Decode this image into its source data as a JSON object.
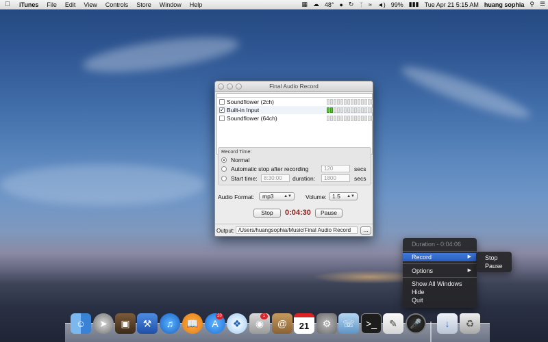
{
  "menubar": {
    "app_name": "iTunes",
    "menus": [
      "File",
      "Edit",
      "View",
      "Controls",
      "Store",
      "Window",
      "Help"
    ],
    "status": {
      "temperature": "48°",
      "battery": "99%",
      "datetime": "Tue Apr 21  5:15 AM",
      "user": "huang sophia"
    }
  },
  "window": {
    "title": "Final Audio Record",
    "devices": [
      {
        "name": "Soundflower (2ch)",
        "checked": false,
        "level": 0
      },
      {
        "name": "Built-in Input",
        "checked": true,
        "level": 0.14
      },
      {
        "name": "Soundflower (64ch)",
        "checked": false,
        "level": 0
      }
    ],
    "record_time": {
      "label": "Record Time:",
      "options": [
        {
          "label": "Normal",
          "selected": true
        },
        {
          "label": "Automatic stop after recording",
          "selected": false
        },
        {
          "label": "Start time:",
          "selected": false
        }
      ],
      "auto_stop_value": "120",
      "secs_label": "secs",
      "start_time_value": "8:30:00",
      "duration_label": "duration:",
      "duration_value": "1800"
    },
    "audio_format_label": "Audio Format:",
    "audio_format_value": "mp3",
    "volume_label": "Volume:",
    "volume_value": "1.5",
    "stop_label": "Stop",
    "elapsed": "0:04:30",
    "pause_label": "Pause",
    "output_label": "Output:",
    "output_path": "/Users/huangsophia/Music/Final Audio Record",
    "browse_label": "..."
  },
  "context_menu": {
    "duration": "Duration - 0:04:06",
    "record": "Record",
    "options": "Options",
    "show_all": "Show All Windows",
    "hide": "Hide",
    "quit": "Quit",
    "submenu": {
      "stop": "Stop",
      "pause": "Pause"
    }
  },
  "dock": {
    "icons": [
      "finder-icon",
      "launchpad-icon",
      "photo-icon",
      "xcode-icon",
      "itunes-icon",
      "ibooks-icon",
      "app-store-icon",
      "safari-icon",
      "facetime-icon",
      "contacts-icon",
      "calendar-icon",
      "system-preferences-icon",
      "network-icon",
      "terminal-icon",
      "textedit-icon",
      "final-audio-record-icon",
      "downloads-icon",
      "trash-icon"
    ],
    "app_store_badge": "20",
    "facetime_badge": "1",
    "calendar_day": "21"
  }
}
